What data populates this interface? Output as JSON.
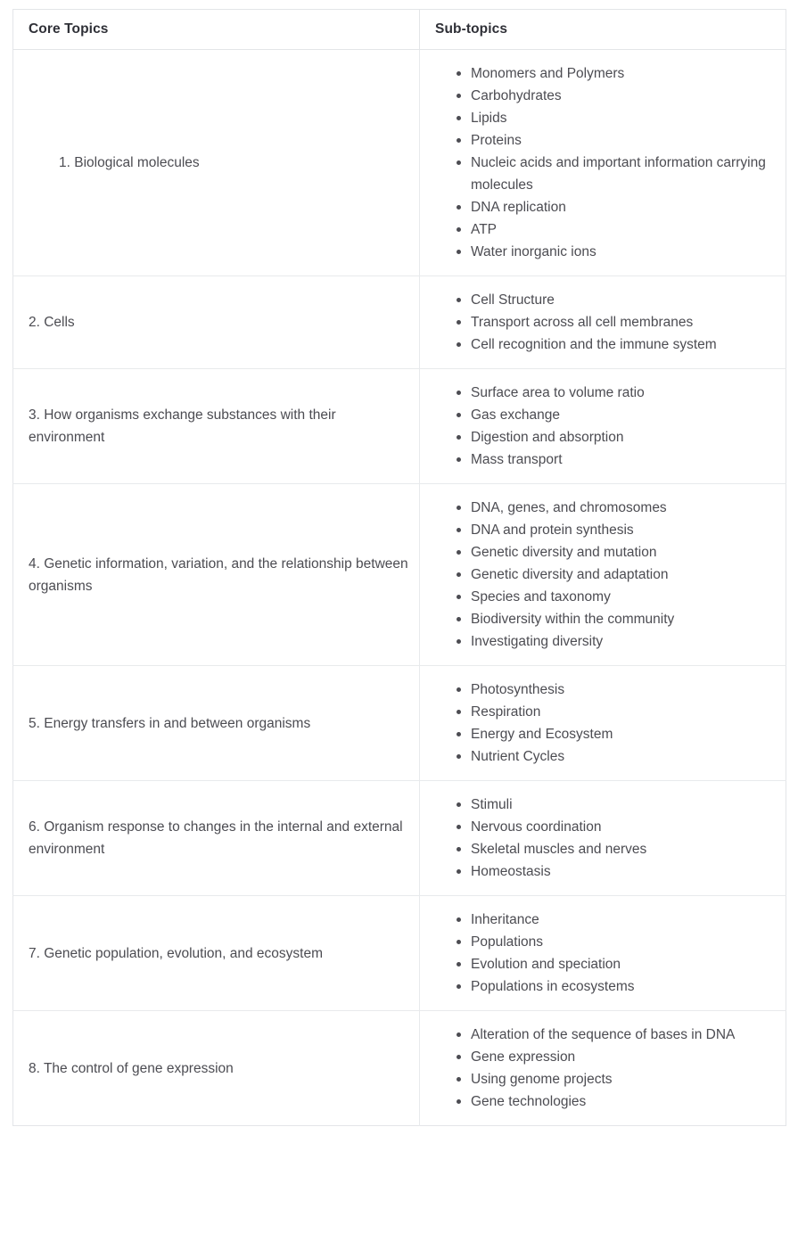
{
  "table": {
    "headers": {
      "core": "Core Topics",
      "sub": "Sub-topics"
    },
    "rows": [
      {
        "core": "1. Biological molecules",
        "indented": true,
        "sub": [
          "Monomers and Polymers",
          "Carbohydrates",
          "Lipids",
          "Proteins",
          "Nucleic acids and important information carrying molecules",
          "DNA replication",
          "ATP",
          "Water inorganic ions"
        ]
      },
      {
        "core": "2. Cells",
        "indented": false,
        "sub": [
          "Cell Structure",
          "Transport across all cell membranes",
          "Cell recognition and the immune system"
        ]
      },
      {
        "core": "3. How organisms exchange substances with their environment",
        "indented": false,
        "sub": [
          "Surface area to volume ratio",
          "Gas exchange",
          "Digestion and absorption",
          "Mass transport"
        ]
      },
      {
        "core": "4. Genetic information, variation, and the relationship between organisms",
        "indented": false,
        "sub": [
          "DNA, genes, and chromosomes",
          "DNA and protein synthesis",
          "Genetic diversity and mutation",
          "Genetic diversity and adaptation",
          "Species and taxonomy",
          "Biodiversity within the community",
          "Investigating diversity"
        ]
      },
      {
        "core": "5. Energy transfers in and between organisms",
        "indented": false,
        "sub": [
          "Photosynthesis",
          "Respiration",
          "Energy and Ecosystem",
          "Nutrient Cycles"
        ]
      },
      {
        "core": "6. Organism response to changes in the internal and external environment",
        "indented": false,
        "sub": [
          "Stimuli",
          "Nervous coordination",
          "Skeletal muscles and nerves",
          "Homeostasis"
        ]
      },
      {
        "core": "7. Genetic population, evolution, and ecosystem",
        "indented": false,
        "sub": [
          "Inheritance",
          "Populations",
          "Evolution and speciation",
          "Populations in ecosystems"
        ]
      },
      {
        "core": "8. The control of gene expression",
        "indented": false,
        "sub": [
          "Alteration of the sequence of bases in DNA",
          "Gene expression",
          "Using genome projects",
          "Gene technologies"
        ]
      }
    ]
  },
  "colors": {
    "border": "#e3e5e8",
    "row_border": "#e8eaec",
    "header_text": "#2f3037",
    "body_text": "#4c4c52",
    "background": "#ffffff"
  }
}
